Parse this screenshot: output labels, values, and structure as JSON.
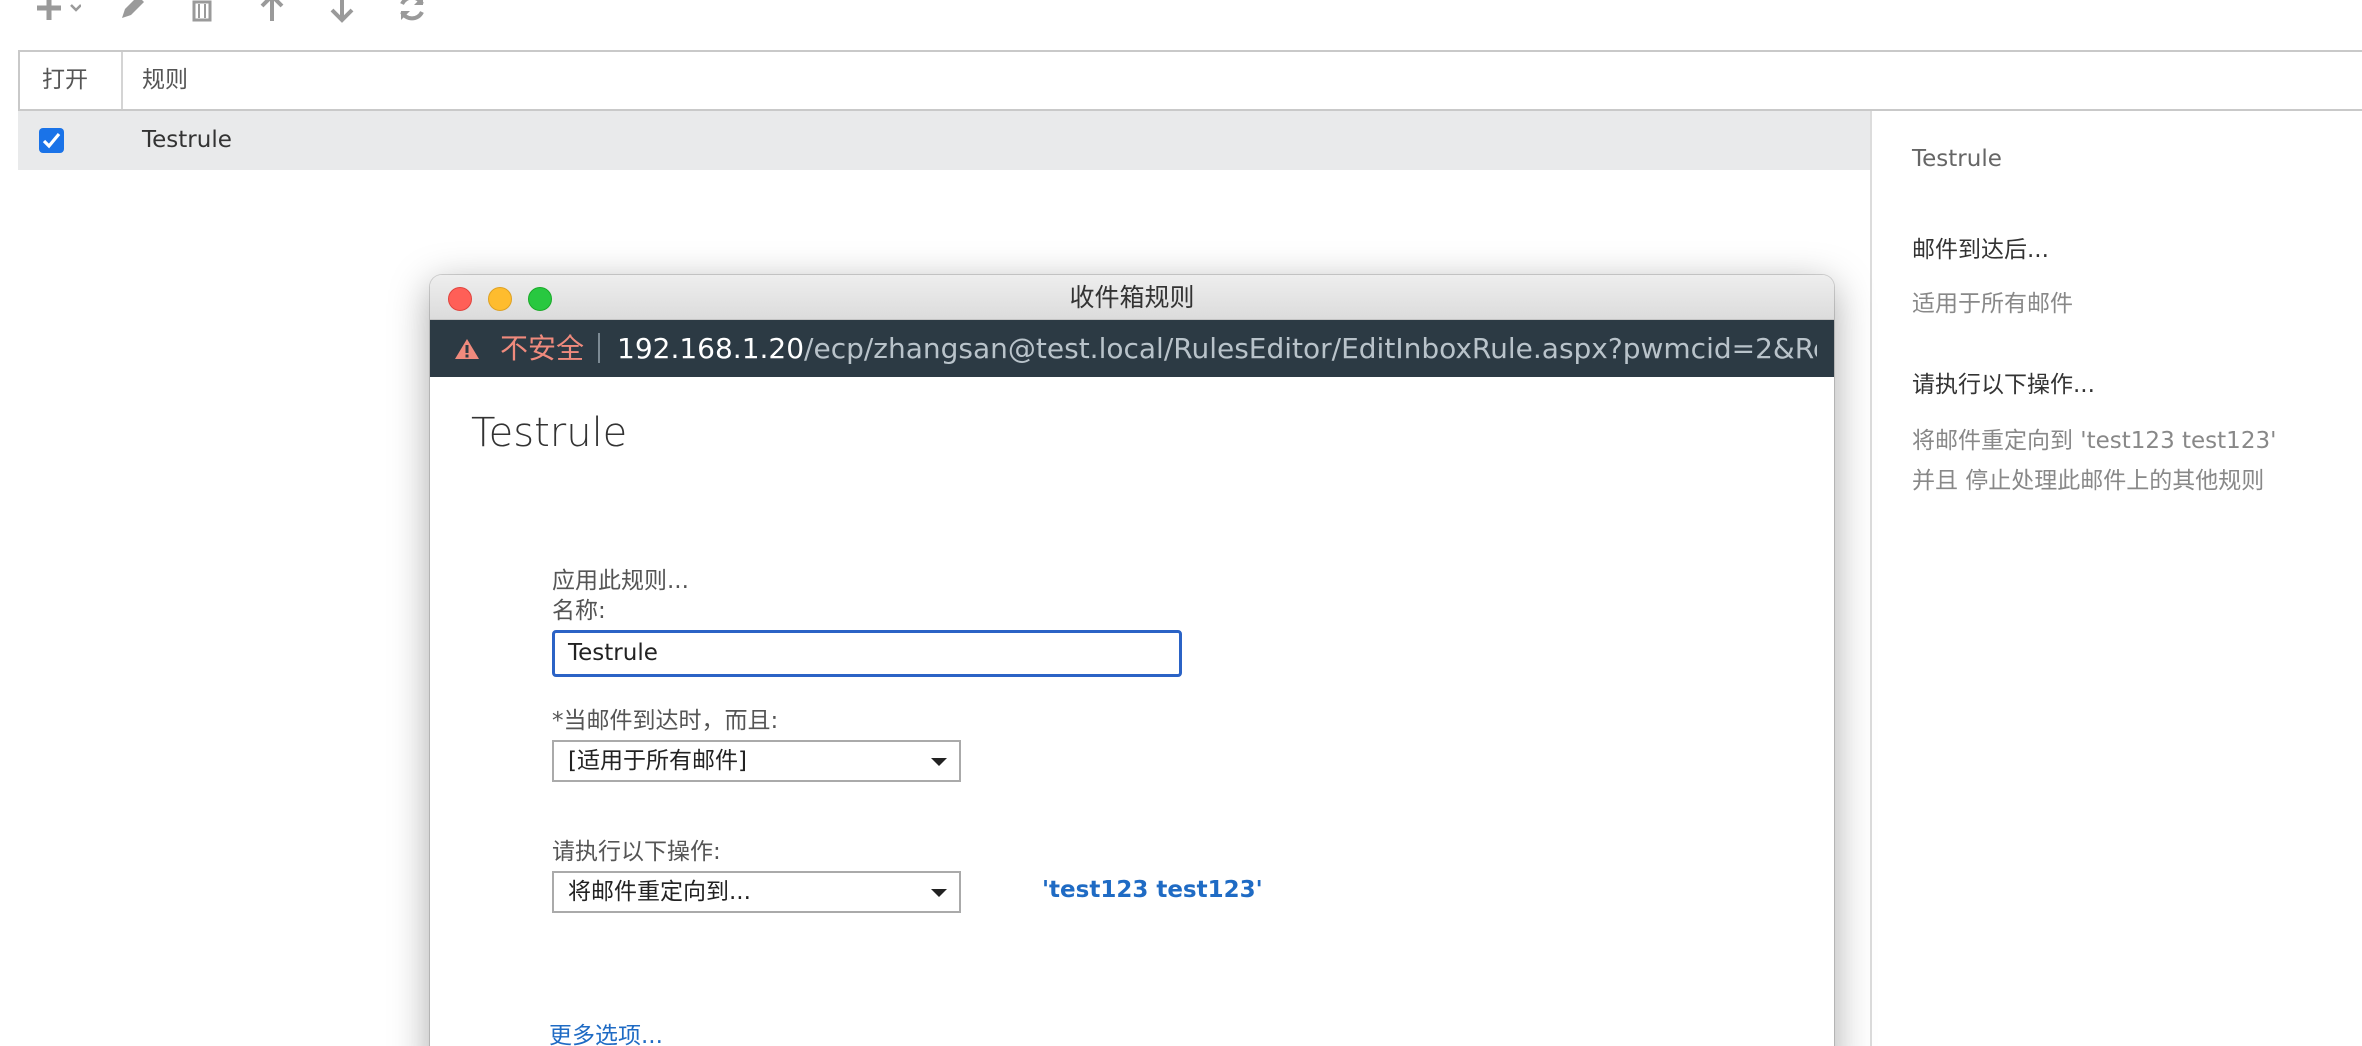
{
  "toolbar": {
    "icons": [
      "add-icon",
      "edit-icon",
      "delete-icon",
      "move-up-icon",
      "move-down-icon",
      "refresh-icon"
    ]
  },
  "list": {
    "columns": [
      "打开",
      "规则"
    ],
    "rows": [
      {
        "enabled": true,
        "name": "Testrule"
      }
    ]
  },
  "details": {
    "title": "Testrule",
    "conditions_heading": "邮件到达后...",
    "conditions_text": "适用于所有邮件",
    "actions_heading": "请执行以下操作...",
    "action_line1": "将邮件重定向到 'test123 test123'",
    "action_line2": "并且 停止处理此邮件上的其他规则"
  },
  "dialog": {
    "window_title": "收件箱规则",
    "security_label": "不安全",
    "url_host": "192.168.1.20",
    "url_path": "/ecp/zhangsan@test.local/RulesEditor/EditInboxRule.aspx?pwmcid=2&Ret...",
    "heading": "Testrule",
    "apply_label": "应用此规则...",
    "name_label": "名称:",
    "name_value": "Testrule",
    "condition_label": "*当邮件到达时，而且:",
    "condition_value": "[适用于所有邮件]",
    "action_label": "请执行以下操作:",
    "action_value": "将邮件重定向到...",
    "recipient_link": "'test123 test123'",
    "more_options": "更多选项..."
  },
  "colors": {
    "accent_blue": "#2b63c6",
    "link_blue": "#1f6bc4",
    "url_bar_bg": "#2c3a44",
    "insecure_red": "#f08a7d",
    "selected_row_bg": "#e9eaeb"
  }
}
